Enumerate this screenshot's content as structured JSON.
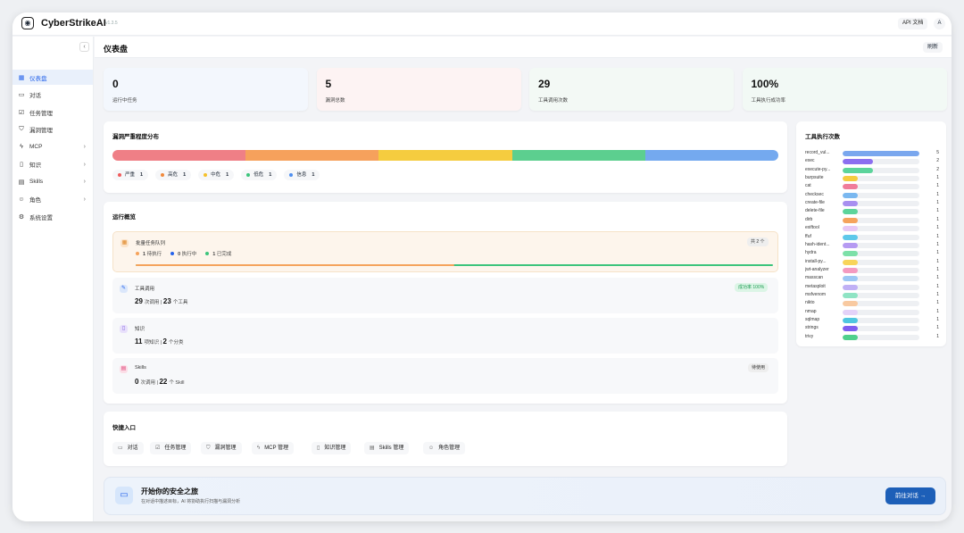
{
  "app": {
    "name": "CyberStrikeAI",
    "version": "v1.3.5",
    "api_docs": "API 文档",
    "avatar": "A"
  },
  "sidebar": {
    "collapse": "‹",
    "items": [
      {
        "label": "仪表盘",
        "icon": "dashboard-icon",
        "glyph": "▦",
        "active": true,
        "chevron": false
      },
      {
        "label": "对话",
        "icon": "chat-icon",
        "glyph": "▭",
        "active": false,
        "chevron": false
      },
      {
        "label": "任务管理",
        "icon": "task-icon",
        "glyph": "☑",
        "active": false,
        "chevron": false
      },
      {
        "label": "漏洞管理",
        "icon": "shield-icon",
        "glyph": "⛉",
        "active": false,
        "chevron": false
      },
      {
        "label": "MCP",
        "icon": "lightning-icon",
        "glyph": "ϟ",
        "active": false,
        "chevron": true
      },
      {
        "label": "知识",
        "icon": "book-icon",
        "glyph": "▯",
        "active": false,
        "chevron": true
      },
      {
        "label": "Skills",
        "icon": "file-icon",
        "glyph": "▤",
        "active": false,
        "chevron": true
      },
      {
        "label": "角色",
        "icon": "users-icon",
        "glyph": "☺",
        "active": false,
        "chevron": true
      },
      {
        "label": "系统设置",
        "icon": "gear-icon",
        "glyph": "⚙",
        "active": false,
        "chevron": false
      }
    ]
  },
  "header": {
    "title": "仪表盘",
    "refresh": "刷新"
  },
  "stats": [
    {
      "value": "0",
      "label": "运行中任务",
      "bg": "#f3f7fd"
    },
    {
      "value": "5",
      "label": "漏洞总数",
      "bg": "#fdf3f3"
    },
    {
      "value": "29",
      "label": "工具调用次数",
      "bg": "#f3f9f5"
    },
    {
      "value": "100%",
      "label": "工具执行成功率",
      "bg": "#f2f9f5"
    }
  ],
  "severity": {
    "title": "漏洞严重程度分布",
    "colors": [
      "#ef7f86",
      "#f6a15c",
      "#f5cc3f",
      "#5ccf8f",
      "#74a9ef"
    ],
    "items": [
      {
        "label": "严重",
        "count": "1",
        "color": "#ef5b5b"
      },
      {
        "label": "高危",
        "count": "1",
        "color": "#f08a3c"
      },
      {
        "label": "中危",
        "count": "1",
        "color": "#f5c02a"
      },
      {
        "label": "低危",
        "count": "1",
        "color": "#3cc47c"
      },
      {
        "label": "信息",
        "count": "1",
        "color": "#4f8ff0"
      }
    ]
  },
  "overview": {
    "title": "运行概览",
    "batch": {
      "title": "批量任务队列",
      "badge": "共 2 个",
      "pending_n": "1",
      "pending_l": "待执行",
      "running_n": "0",
      "running_l": "执行中",
      "done_n": "1",
      "done_l": "已完成",
      "progress": 0.5
    },
    "tools": {
      "title": "工具调用",
      "calls": "29",
      "calls_l": "次调用",
      "tools": "23",
      "tools_l": "个工具",
      "badge": "成功率 100%"
    },
    "knowledge": {
      "title": "知识",
      "items": "11",
      "items_l": "项知识",
      "cats": "2",
      "cats_l": "个分类"
    },
    "skills": {
      "title": "Skills",
      "calls": "0",
      "calls_l": "次调用",
      "skills": "22",
      "skills_l": "个 Skill",
      "badge": "待使用"
    }
  },
  "quick": {
    "title": "快捷入口",
    "items": [
      {
        "label": "对话",
        "icon": "chat-icon",
        "glyph": "▭"
      },
      {
        "label": "任务管理",
        "icon": "task-icon",
        "glyph": "☑"
      },
      {
        "label": "漏洞管理",
        "icon": "shield-icon",
        "glyph": "⛉"
      },
      {
        "label": "MCP 管理",
        "icon": "lightning-icon",
        "glyph": "ϟ"
      },
      {
        "label": "知识管理",
        "icon": "book-icon",
        "glyph": "▯"
      },
      {
        "label": "Skills 管理",
        "icon": "file-icon",
        "glyph": "▤"
      },
      {
        "label": "角色管理",
        "icon": "users-icon",
        "glyph": "☺"
      }
    ]
  },
  "tools": {
    "title": "工具执行次数",
    "max": 5,
    "items": [
      {
        "name": "record_vul...",
        "count": 5,
        "color": "#7aa7ee"
      },
      {
        "name": "exec",
        "count": 2,
        "color": "#8b6ff0"
      },
      {
        "name": "execute-py...",
        "count": 2,
        "color": "#5cd49b"
      },
      {
        "name": "burpsuite",
        "count": 1,
        "color": "#f5cc3f"
      },
      {
        "name": "cat",
        "count": 1,
        "color": "#f07c9a"
      },
      {
        "name": "checksec",
        "count": 1,
        "color": "#7ab8f0"
      },
      {
        "name": "create-file",
        "count": 1,
        "color": "#a88ff0"
      },
      {
        "name": "delete-file",
        "count": 1,
        "color": "#5cd49b"
      },
      {
        "name": "dirb",
        "count": 1,
        "color": "#f5a35c"
      },
      {
        "name": "exiftool",
        "count": 1,
        "color": "#e7c8f5"
      },
      {
        "name": "ffuf",
        "count": 1,
        "color": "#5ec8ea"
      },
      {
        "name": "hash-ident...",
        "count": 1,
        "color": "#b59af2"
      },
      {
        "name": "hydra",
        "count": 1,
        "color": "#7de0a8"
      },
      {
        "name": "install-py...",
        "count": 1,
        "color": "#f8d45a"
      },
      {
        "name": "jwt-analyzer",
        "count": 1,
        "color": "#f49ac0"
      },
      {
        "name": "masscan",
        "count": 1,
        "color": "#9cc7f4"
      },
      {
        "name": "metasploit",
        "count": 1,
        "color": "#c0b0f5"
      },
      {
        "name": "msfvenom",
        "count": 1,
        "color": "#8fe4c4"
      },
      {
        "name": "nikto",
        "count": 1,
        "color": "#f8c9a0"
      },
      {
        "name": "nmap",
        "count": 1,
        "color": "#e4d2f8"
      },
      {
        "name": "sqlmap",
        "count": 1,
        "color": "#4fc6e0"
      },
      {
        "name": "strings",
        "count": 1,
        "color": "#7f5ef0"
      },
      {
        "name": "trivy",
        "count": 1,
        "color": "#4fd08c"
      }
    ]
  },
  "banner": {
    "title": "开始你的安全之旅",
    "subtitle": "在对话中描述目标，AI 将协助执行扫描与漏洞分析",
    "button": "前往对话 →"
  }
}
